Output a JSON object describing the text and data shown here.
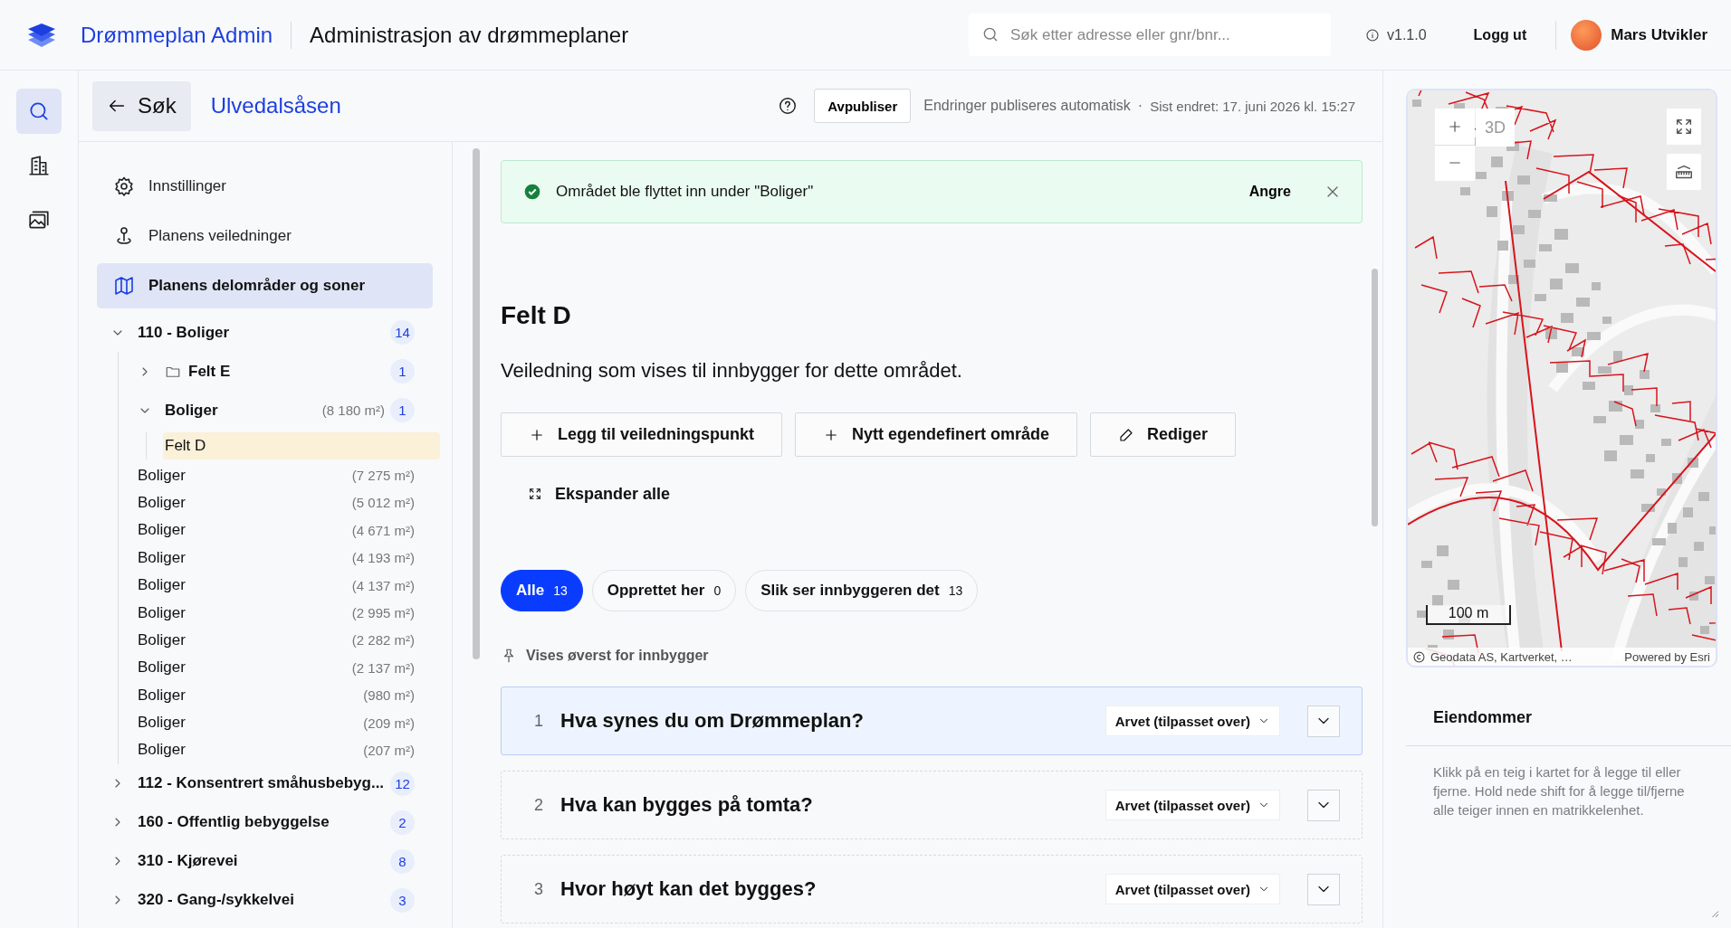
{
  "header": {
    "app_name": "Drømmeplan Admin",
    "subtitle": "Administrasjon av drømmeplaner",
    "search": {
      "placeholder": "Søk etter adresse eller gnr/bnr..."
    },
    "version": "v1.1.0",
    "logout": "Logg ut",
    "user": "Mars Utvikler"
  },
  "rail": [
    {
      "kind": "search",
      "selected": true
    },
    {
      "kind": "building",
      "selected": false
    },
    {
      "kind": "images",
      "selected": false
    }
  ],
  "topbar": {
    "back": "Søk",
    "plan": "Ulvedalsåsen",
    "unpublish": "Avpubliser",
    "autosave": "Endringer publiseres automatisk",
    "separator": "·",
    "last_changed": "Sist endret: 17. juni 2026 kl. 15:27"
  },
  "nav": [
    {
      "kind": "settings",
      "label": "Innstillinger",
      "selected": false
    },
    {
      "kind": "guide",
      "label": "Planens veiledninger",
      "selected": false
    },
    {
      "kind": "map",
      "label": "Planens delområder og soner",
      "selected": true
    }
  ],
  "tree": [
    {
      "kind": "group",
      "label": "110 - Boliger",
      "count": "14",
      "expanded": true,
      "children": [
        {
          "kind": "folder",
          "label": "Felt E",
          "count": "1",
          "expanded": false
        },
        {
          "kind": "group",
          "label": "Boliger",
          "area": "(8 180 m²)",
          "count": "1",
          "expanded": true,
          "children": [
            {
              "kind": "leaf",
              "label": "Felt D",
              "selected": true
            }
          ]
        },
        {
          "kind": "leaf",
          "label": "Boliger",
          "area": "(7 275 m²)",
          "selected": false
        },
        {
          "kind": "leaf",
          "label": "Boliger",
          "area": "(5 012 m²)",
          "selected": false
        },
        {
          "kind": "leaf",
          "label": "Boliger",
          "area": "(4 671 m²)",
          "selected": false
        },
        {
          "kind": "leaf",
          "label": "Boliger",
          "area": "(4 193 m²)",
          "selected": false
        },
        {
          "kind": "leaf",
          "label": "Boliger",
          "area": "(4 137 m²)",
          "selected": false
        },
        {
          "kind": "leaf",
          "label": "Boliger",
          "area": "(2 995 m²)",
          "selected": false
        },
        {
          "kind": "leaf",
          "label": "Boliger",
          "area": "(2 282 m²)",
          "selected": false
        },
        {
          "kind": "leaf",
          "label": "Boliger",
          "area": "(2 137 m²)",
          "selected": false
        },
        {
          "kind": "leaf",
          "label": "Boliger",
          "area": "(980 m²)",
          "selected": false
        },
        {
          "kind": "leaf",
          "label": "Boliger",
          "area": "(209 m²)",
          "selected": false
        },
        {
          "kind": "leaf",
          "label": "Boliger",
          "area": "(207 m²)",
          "selected": false
        }
      ]
    },
    {
      "kind": "group",
      "label": "112 - Konsentrert småhusbebyg...",
      "count": "12",
      "expanded": false
    },
    {
      "kind": "group",
      "label": "160 - Offentlig bebyggelse",
      "count": "2",
      "expanded": false
    },
    {
      "kind": "group",
      "label": "310 - Kjørevei",
      "count": "8",
      "expanded": false
    },
    {
      "kind": "group",
      "label": "320 - Gang-/sykkelvei",
      "count": "3",
      "expanded": false
    }
  ],
  "toast": {
    "message": "Området ble flyttet inn under \"Boliger\"",
    "undo": "Angre"
  },
  "area": {
    "title": "Felt D",
    "description": "Veiledning som vises til innbygger for dette området.",
    "actions": [
      {
        "kind": "add",
        "label": "Legg til veiledningspunkt"
      },
      {
        "kind": "add",
        "label": "Nytt egendefinert område"
      },
      {
        "kind": "edit",
        "label": "Rediger"
      }
    ],
    "expand_all": "Ekspander alle"
  },
  "filters": [
    {
      "label": "Alle",
      "count": "13",
      "selected": true
    },
    {
      "label": "Opprettet her",
      "count": "0",
      "selected": false
    },
    {
      "label": "Slik ser innbyggeren det",
      "count": "13",
      "selected": false
    }
  ],
  "pinned_label": "Vises øverst for innbygger",
  "questions": [
    {
      "number": "1",
      "title": "Hva synes du om Drømmeplan?",
      "status": "Arvet (tilpasset over)",
      "selected": true
    },
    {
      "number": "2",
      "title": "Hva kan bygges på tomta?",
      "status": "Arvet (tilpasset over)",
      "selected": false
    },
    {
      "number": "3",
      "title": "Hvor høyt kan det bygges?",
      "status": "Arvet (tilpasset over)",
      "selected": false
    }
  ],
  "map": {
    "kind": "picture",
    "mode": "3D",
    "scale": "100 m",
    "attribution": "Geodata AS, Kartverket, …",
    "powered": "Powered by Esri"
  },
  "properties": {
    "title": "Eiendommer",
    "hint": "Klikk på en teig i kartet for å legge til eller fjerne. Hold nede shift for å legge til/fjerne alle teiger innen en matrikkelenhet."
  }
}
